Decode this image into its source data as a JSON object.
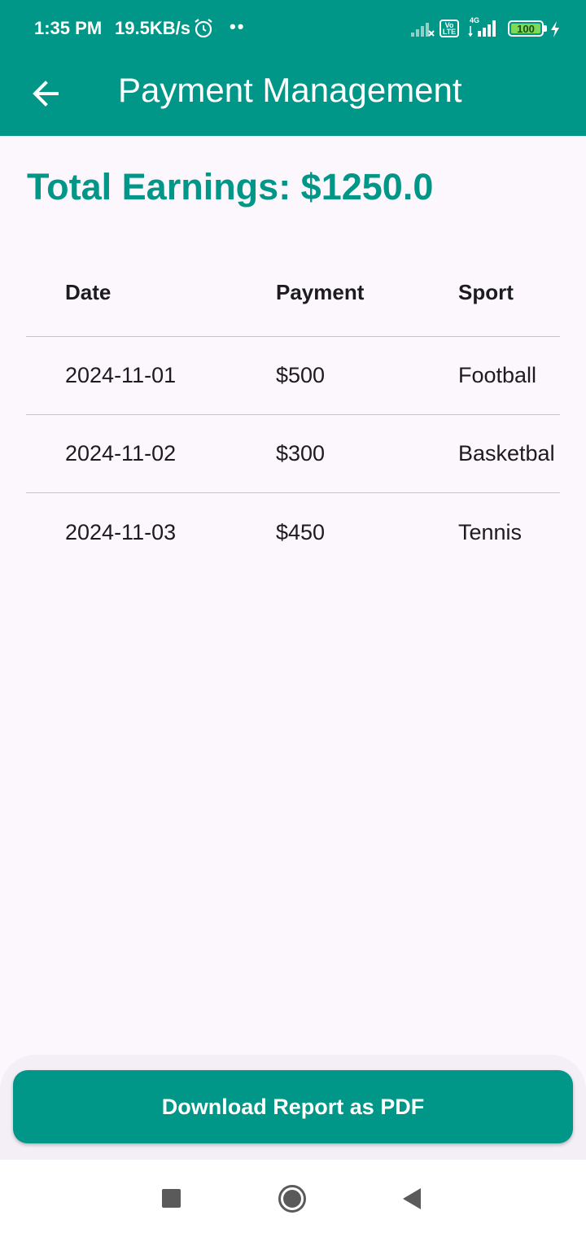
{
  "status_bar": {
    "time": "1:35 PM",
    "net_speed": "19.5KB/s",
    "dots": "••",
    "volte": "Vo LTE",
    "network": "4G",
    "battery": "100"
  },
  "app_bar": {
    "title": "Payment Management",
    "back_icon": "arrow-back-icon"
  },
  "summary": {
    "total_earnings": "Total Earnings: $1250.0"
  },
  "table": {
    "headers": [
      "Date",
      "Payment",
      "Sport"
    ],
    "rows": [
      [
        "2024-11-01",
        "$500",
        "Football"
      ],
      [
        "2024-11-02",
        "$300",
        "Basketbal"
      ],
      [
        "2024-11-03",
        "$450",
        "Tennis"
      ]
    ]
  },
  "actions": {
    "download_label": "Download Report as PDF"
  },
  "colors": {
    "primary": "#009688",
    "background": "#fcf7fd",
    "divider": "#c9c2ca",
    "text": "#1c1b1f"
  }
}
